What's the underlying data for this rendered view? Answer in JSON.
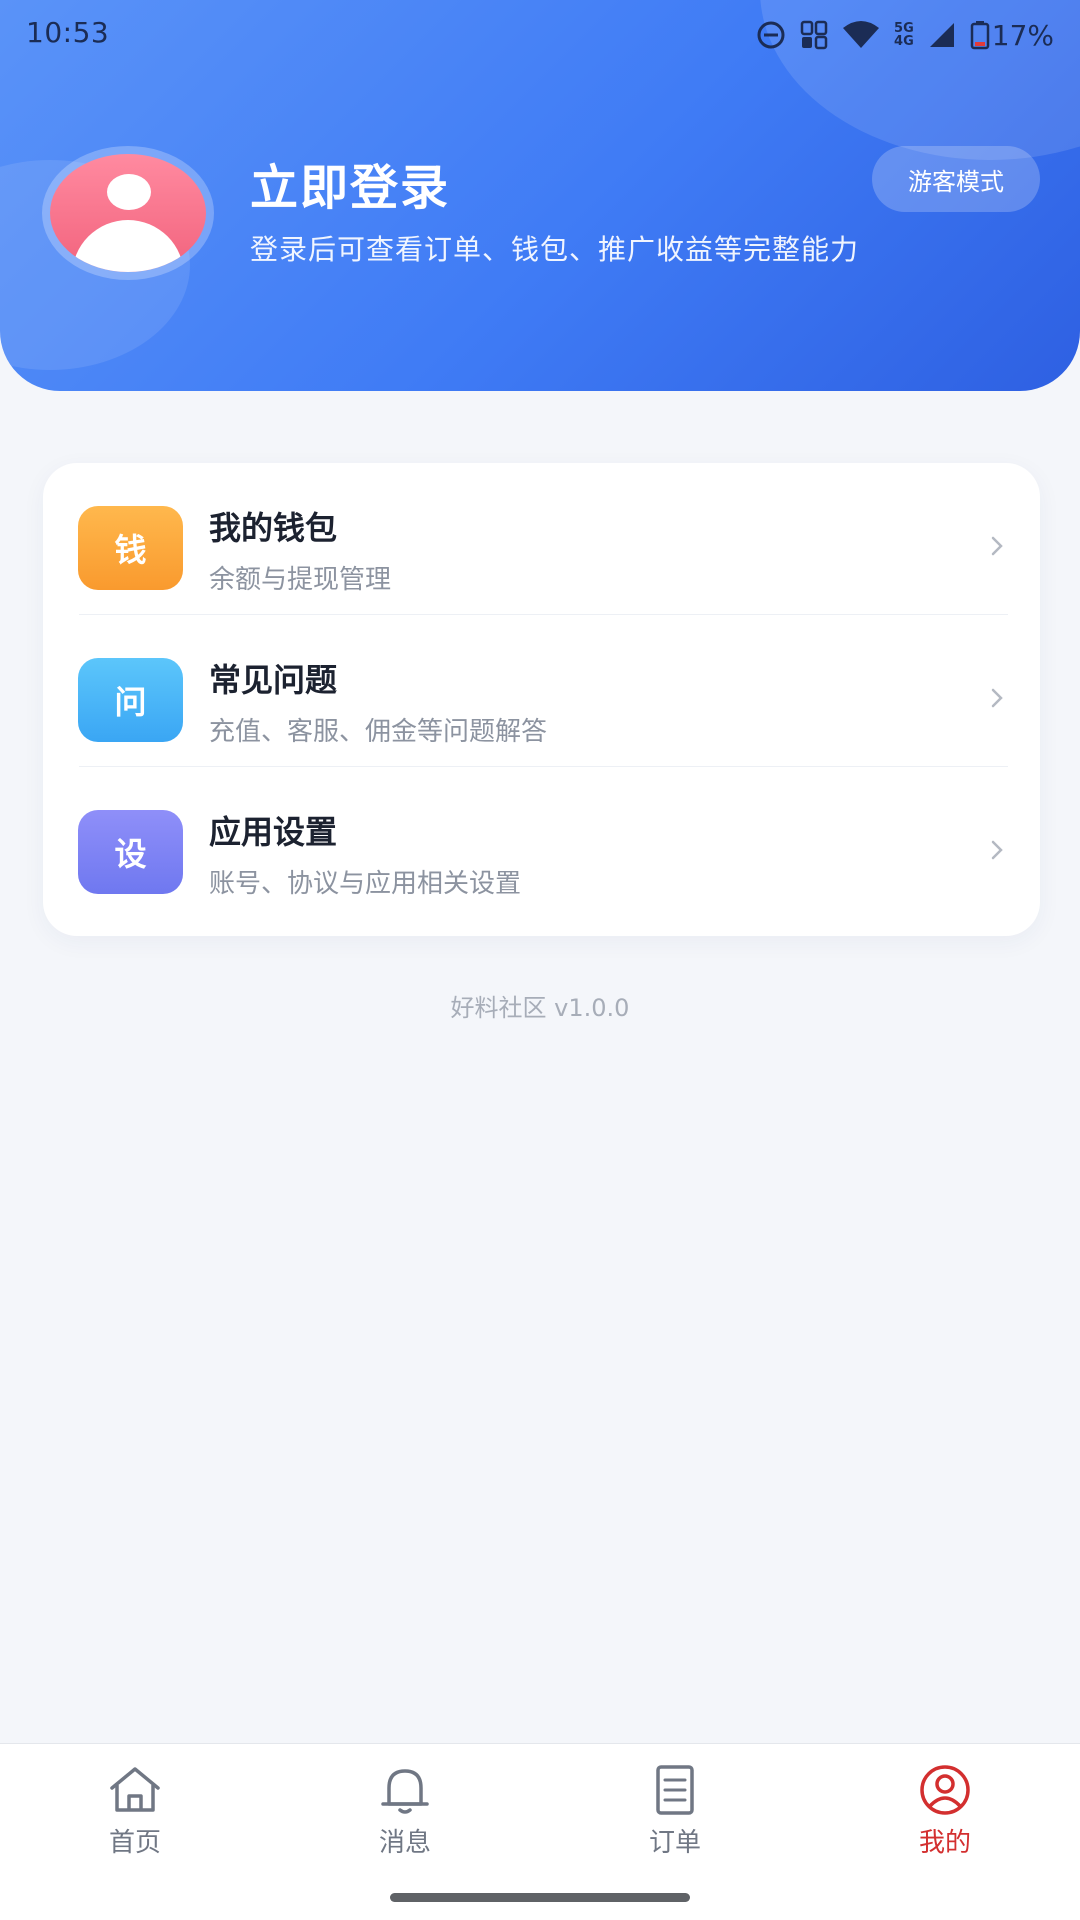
{
  "status_bar": {
    "time": "10:53",
    "battery_percent": "17%",
    "network_label_top": "5G",
    "network_label_bottom": "4G",
    "icons": [
      "do-not-disturb-icon",
      "sim-icon",
      "wifi-icon",
      "signal-icon",
      "battery-icon"
    ]
  },
  "profile": {
    "title": "立即登录",
    "subtitle": "登录后可查看订单、钱包、推广收益等完整能力",
    "guest_button": "游客模式",
    "avatar_icon": "user-avatar-icon"
  },
  "menu": {
    "items": [
      {
        "icon_text": "钱",
        "title": "我的钱包",
        "desc": "余额与提现管理",
        "color_from": "#ffb84d",
        "color_to": "#f99a2e"
      },
      {
        "icon_text": "问",
        "title": "常见问题",
        "desc": "充值、客服、佣金等问题解答",
        "color_from": "#5cc6fb",
        "color_to": "#3aa6f4"
      },
      {
        "icon_text": "设",
        "title": "应用设置",
        "desc": "账号、协议与应用相关设置",
        "color_from": "#8f8ff9",
        "color_to": "#6f78f0"
      }
    ]
  },
  "footer": {
    "version": "好料社区 v1.0.0"
  },
  "bottom_nav": {
    "active_color": "#d32f2f",
    "items": [
      {
        "label": "首页",
        "icon": "home-icon"
      },
      {
        "label": "消息",
        "icon": "bell-icon"
      },
      {
        "label": "订单",
        "icon": "document-icon"
      },
      {
        "label": "我的",
        "icon": "user-icon",
        "active": true
      }
    ]
  }
}
